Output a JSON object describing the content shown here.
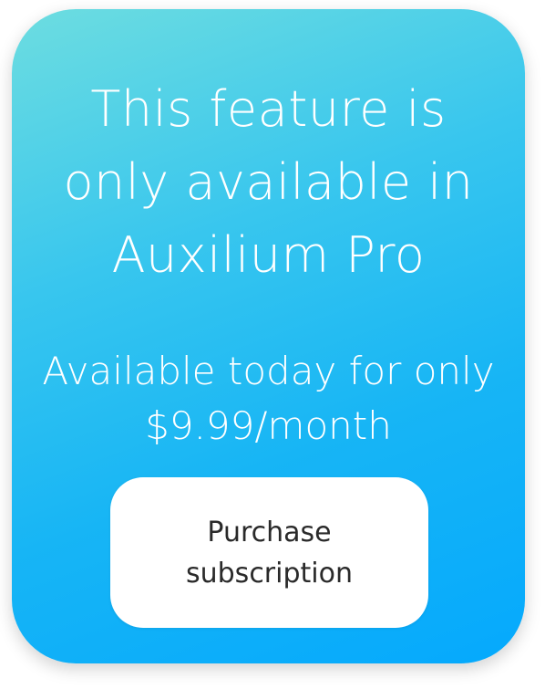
{
  "paywall": {
    "headline_lines": [
      "This feature is",
      "only available in",
      "Auxilium Pro"
    ],
    "offer_lines": [
      "Available today for only",
      "$9.99/month"
    ],
    "purchase_button_lines": [
      "Purchase",
      "subscription"
    ]
  },
  "colors": {
    "gradient_start": "#6ddde0",
    "gradient_end": "#05a9fd",
    "text_on_card": "#ffffff",
    "button_background": "#ffffff",
    "button_text": "#2a2a2a"
  }
}
